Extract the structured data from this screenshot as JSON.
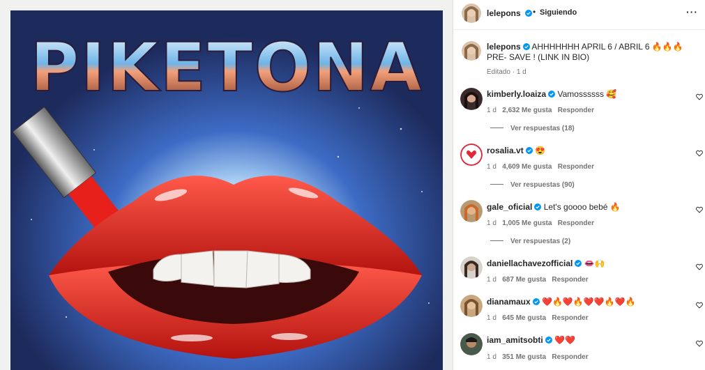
{
  "post": {
    "author": "lelepons",
    "follow_status": "Siguiendo",
    "caption_user": "lelepons",
    "caption_text": "AHHHHHHH APRIL 6 / ABRIL 6 🔥🔥🔥PRE- SAVE ! (LINK IN BIO)",
    "edited": "Editado",
    "age": "1 d"
  },
  "poster": {
    "title": "PIKETONA"
  },
  "comments": [
    {
      "user": "kimberly.loaiza",
      "text": "Vamossssss 🥰",
      "age": "1 d",
      "likes": "2,632 Me gusta",
      "reply": "Responder",
      "view_replies": "Ver respuestas (18)"
    },
    {
      "user": "rosalia.vt",
      "text": "😍",
      "age": "1 d",
      "likes": "4,609 Me gusta",
      "reply": "Responder",
      "view_replies": "Ver respuestas (90)"
    },
    {
      "user": "gale_oficial",
      "text": "Let's goooo bebé 🔥",
      "age": "1 d",
      "likes": "1,005 Me gusta",
      "reply": "Responder",
      "view_replies": "Ver respuestas (2)"
    },
    {
      "user": "daniellachavezofficial",
      "text": "👄🙌",
      "age": "1 d",
      "likes": "687 Me gusta",
      "reply": "Responder"
    },
    {
      "user": "dianamaux",
      "text": "❤️🔥❤️🔥❤️❤️🔥❤️🔥",
      "age": "1 d",
      "likes": "645 Me gusta",
      "reply": "Responder"
    },
    {
      "user": "iam_amitsobti",
      "text": "❤️❤️",
      "age": "1 d",
      "likes": "351 Me gusta",
      "reply": "Responder"
    }
  ],
  "colors": {
    "verified": "#0095f6",
    "lips": "#e0261f",
    "poster_bg": "#2a3d7a"
  }
}
